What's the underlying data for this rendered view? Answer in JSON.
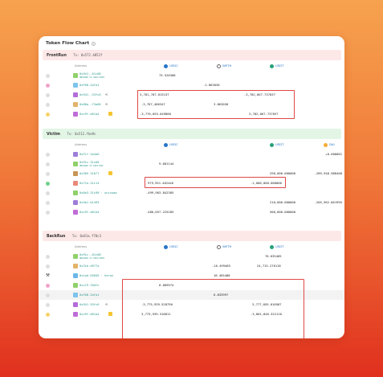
{
  "title": "Token Flow Chart",
  "columns": {
    "address": "Address"
  },
  "frontrun": {
    "name": "FrontRun",
    "tx": "Tx: 0x572.4052f",
    "tokens": [
      "USDC",
      "WETH",
      "USDT"
    ],
    "rows": [
      {
        "addr": "0x941..01c08",
        "sub": "UNISWAP V3 USDC/USDT",
        "v": [
          "75.520308",
          "",
          ""
        ]
      },
      {
        "addr": "0xF68.2afa1",
        "v": [
          "",
          "-1.863030",
          ""
        ]
      },
      {
        "addr": "0x941..53fc6",
        "v": [
          "3,781,707.015137",
          "",
          "-3,782,067.737037"
        ]
      },
      {
        "addr": "0x88a..f3a06",
        "v": [
          "-3,767,486347",
          "3.863030",
          ""
        ]
      },
      {
        "addr": "0xc9f.d61a4",
        "v": [
          "-3,776,055.049800",
          "",
          "3,782,067.737037"
        ]
      }
    ]
  },
  "victim": {
    "name": "Victim",
    "tx": "Tx: 0x512.fbe9c",
    "tokens": [
      "USDC",
      "USDT",
      "DAI"
    ],
    "rows": [
      {
        "addr": "0xF1f.1b4a6",
        "v": [
          "",
          "",
          "+0.000001"
        ]
      },
      {
        "addr": "0x91c.31c68",
        "sub": "UNISWAP V3 USDC/DAI",
        "v": [
          "9.681144",
          "",
          ""
        ]
      },
      {
        "addr": "0x305.31077",
        "v": [
          "",
          "290,000.000000",
          "-289,948.988400"
        ]
      },
      {
        "addr": "0x71a.31c14",
        "v": [
          "979,951.462446",
          "-1,000,000.000000",
          ""
        ]
      },
      {
        "addr": "0x8a3.31c98 · uniswap",
        "v": [
          "-499,963.842385",
          "",
          ""
        ]
      },
      {
        "addr": "0x5b1.b1495",
        "v": [
          "",
          "210,000.000000",
          "-205,962.861995"
        ]
      },
      {
        "addr": "0xc9f.d61a4",
        "v": [
          "-480,057.225285",
          "500,000.000000",
          ""
        ]
      }
    ]
  },
  "backrun": {
    "name": "BackRun",
    "tx": "Tx: 0x81a.f78c3",
    "tokens": [
      "USDC",
      "WETH",
      "USDT"
    ],
    "rows": [
      {
        "addr": "0x91c..01c08",
        "sub": "UNISWAP V3 USDC/USDT",
        "v": [
          "",
          "",
          "76.035405"
        ]
      },
      {
        "addr": "0x31b.d977a",
        "v": [
          "",
          "-16.499485",
          "24,715.276118"
        ]
      },
      {
        "addr": "0x1ad.03836 · heron",
        "v": [
          "",
          "18.465488",
          ""
        ]
      },
      {
        "addr": "0xcf9.f0dfc",
        "v": [
          "0.009974",
          "",
          ""
        ]
      },
      {
        "addr": "0xF68.2afa1",
        "v": [
          "",
          "6.833997",
          ""
        ]
      },
      {
        "addr": "0x941.53fc6",
        "v": [
          "-3,775,939.528790",
          "",
          "3,777,055.010587"
        ]
      },
      {
        "addr": "0xc9f.d61a4",
        "v": [
          "3,775,939.518811",
          "",
          "-3,801,846.322110"
        ]
      }
    ]
  }
}
